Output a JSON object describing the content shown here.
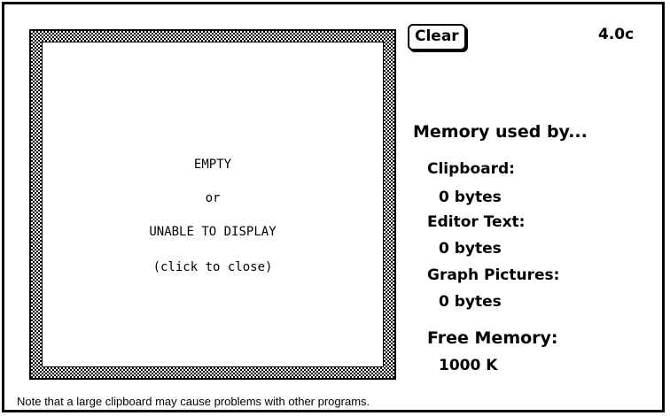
{
  "preview": {
    "line1": "EMPTY",
    "line2": "or",
    "line3": "UNABLE TO DISPLAY",
    "line4": "(click to close)"
  },
  "header": {
    "clear_label": "Clear",
    "version": "4.0c"
  },
  "memory": {
    "title": "Memory used by...",
    "items": [
      {
        "label": "Clipboard:",
        "value": "0 bytes"
      },
      {
        "label": "Editor Text:",
        "value": "0 bytes"
      },
      {
        "label": "Graph Pictures:",
        "value": "0 bytes"
      }
    ],
    "free_label": "Free Memory:",
    "free_value": "1000 K"
  },
  "footer": {
    "note": "Note that a large clipboard may cause problems with other programs."
  },
  "colors": {
    "foreground": "#000000",
    "background": "#ffffff"
  }
}
